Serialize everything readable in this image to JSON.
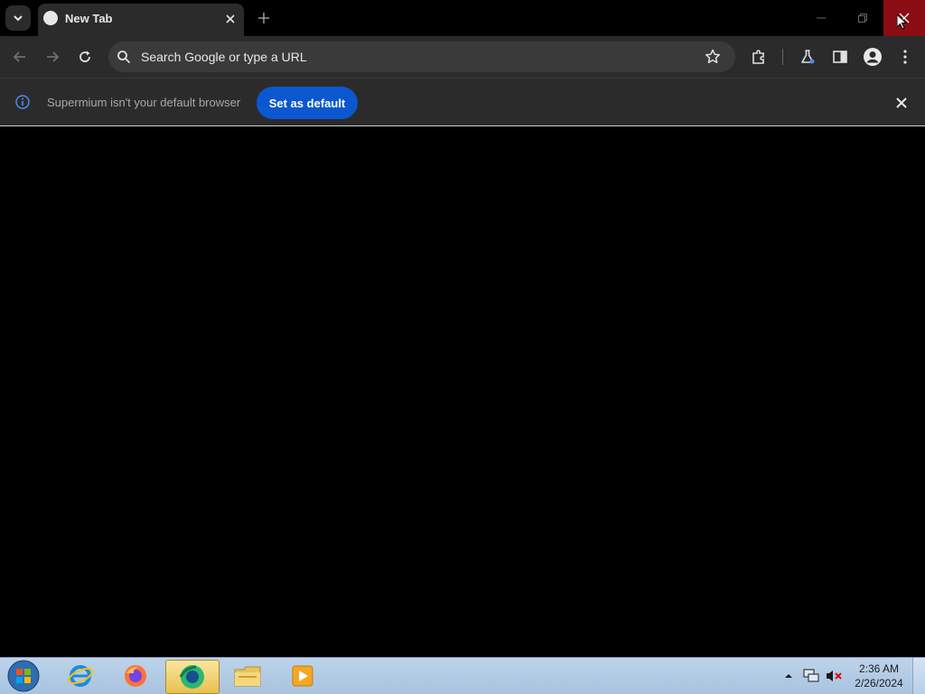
{
  "tabs": [
    {
      "title": "New Tab",
      "active": true
    }
  ],
  "omnibox": {
    "placeholder": "Search Google or type a URL"
  },
  "infobar": {
    "message": "Supermium isn't your default browser",
    "button_label": "Set as default"
  },
  "taskbar": {
    "apps": [
      {
        "name": "internet-explorer-icon"
      },
      {
        "name": "firefox-icon"
      },
      {
        "name": "supermium-icon",
        "active": true
      },
      {
        "name": "file-explorer-icon"
      },
      {
        "name": "media-player-icon"
      }
    ],
    "clock": {
      "time": "2:36 AM",
      "date": "2/26/2024"
    }
  },
  "colors": {
    "accent": "#0b57d0",
    "close_hover": "#8b0d14",
    "toolbar": "#2b2b2b"
  }
}
